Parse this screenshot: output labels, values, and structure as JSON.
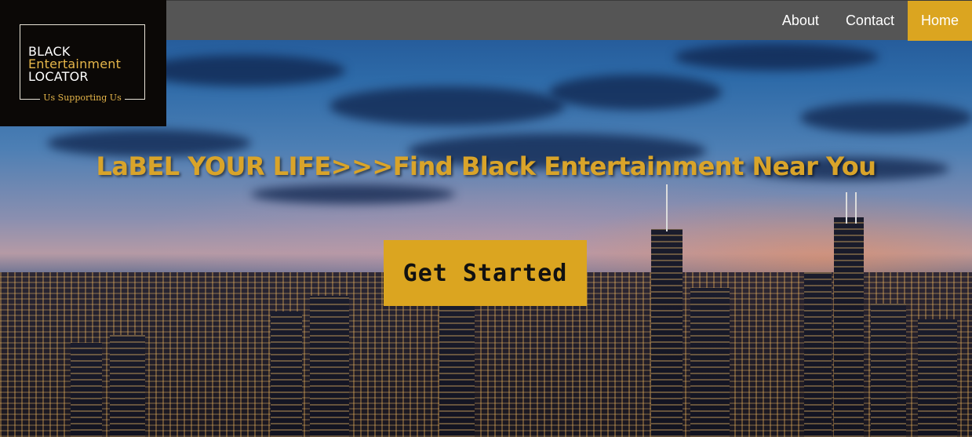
{
  "brand": {
    "line1": "BLACK",
    "line2": "Entertainment",
    "line3": "LOCATOR",
    "tagline": "Us Supporting Us"
  },
  "nav": {
    "items": [
      {
        "label": "About"
      },
      {
        "label": "Contact"
      },
      {
        "label": "Home",
        "active": true
      }
    ]
  },
  "hero": {
    "headline": "LaBEL YOUR LIFE>>>Find Black Entertainment Near You",
    "cta_label": "Get Started"
  },
  "colors": {
    "accent": "#dba520",
    "navbar": "#555555",
    "logo_bg": "#0b0806",
    "headline": "#d9a42a"
  }
}
